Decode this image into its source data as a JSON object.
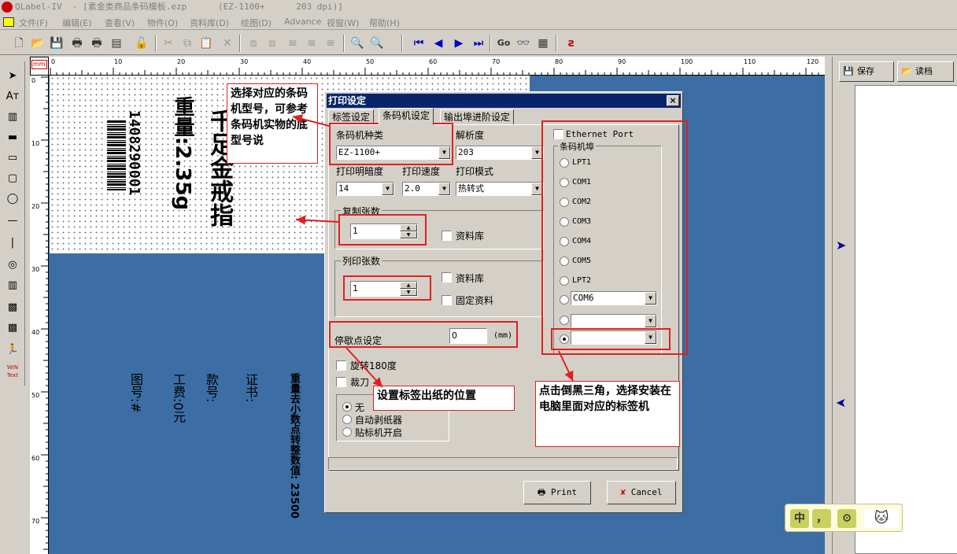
{
  "window": {
    "title": "QLabel-IV  - [素金类商品条码模板.ezp      (EZ-1100+      203 dpi)]"
  },
  "menu": [
    "文件(F)",
    "编辑(E)",
    "查看(V)",
    "物件(O)",
    "资料库(D)",
    "绘图(D)",
    "Advance",
    "视窗(W)",
    "帮助(H)"
  ],
  "toolbar": {
    "go_label": "Go"
  },
  "ruler": {
    "unit": "mm",
    "h_ticks": [
      "0",
      "10",
      "20",
      "30",
      "40",
      "50",
      "60",
      "70",
      "80",
      "90",
      "100",
      "110",
      "120"
    ],
    "v_ticks": [
      "0",
      "10",
      "20",
      "30",
      "40",
      "50",
      "60",
      "70"
    ]
  },
  "label_content": {
    "barcode_number": "1408290001",
    "product_name": "千足金戒指",
    "weight_text": "重量:2.35g",
    "fee_text": "工费:0元",
    "style_text": "款号:",
    "cert_text": "证书:",
    "figure_text": "图号:#",
    "rounding_text": "重量去小数点转整数值: 23500"
  },
  "right_panel": {
    "save_label": "保存",
    "read_label": "读档"
  },
  "dialog": {
    "title": "打印设定",
    "close": "×",
    "tabs": [
      "标签设定",
      "条码机设定",
      "输出埠进阶设定"
    ],
    "printer_type_label": "条码机种类",
    "printer_type_value": "EZ-1100+",
    "resolution_label": "解析度",
    "resolution_value": "203",
    "darkness_label": "打印明暗度",
    "darkness_value": "14",
    "speed_label": "打印速度",
    "speed_value": "2.0",
    "mode_label": "打印模式",
    "mode_value": "热转式",
    "copies_group": "复制张数",
    "copies_value": "1",
    "copies_db": "资料库",
    "cols_group": "列印张数",
    "cols_value": "1",
    "cols_db": "资料库",
    "cols_fixed": "固定资料",
    "stop_label": "停歇点设定",
    "stop_value": "0",
    "stop_unit": "(mm)",
    "rotate_label": "旋转180度",
    "cutter_label": "裁刀",
    "peel_options": [
      "无",
      "自动剥纸器",
      "贴标机开启"
    ],
    "ethernet_label": "Ethernet Port",
    "port_group": "条码机埠",
    "ports": [
      "LPT1",
      "COM1",
      "COM2",
      "COM3",
      "COM4",
      "COM5",
      "LPT2",
      "COM6",
      "",
      ""
    ],
    "print_button": "Print",
    "cancel_button": "Cancel"
  },
  "annotations": {
    "model_note": "选择对应的条码机型号，可参考条码机实物的底型号说",
    "position_note": "设置标签出纸的位置",
    "port_note": "点击倒黑三角，选择安装在电脑里面对应的标签机"
  },
  "ime": {
    "lang": "中",
    "punct": "，",
    "settings": "⚙"
  }
}
